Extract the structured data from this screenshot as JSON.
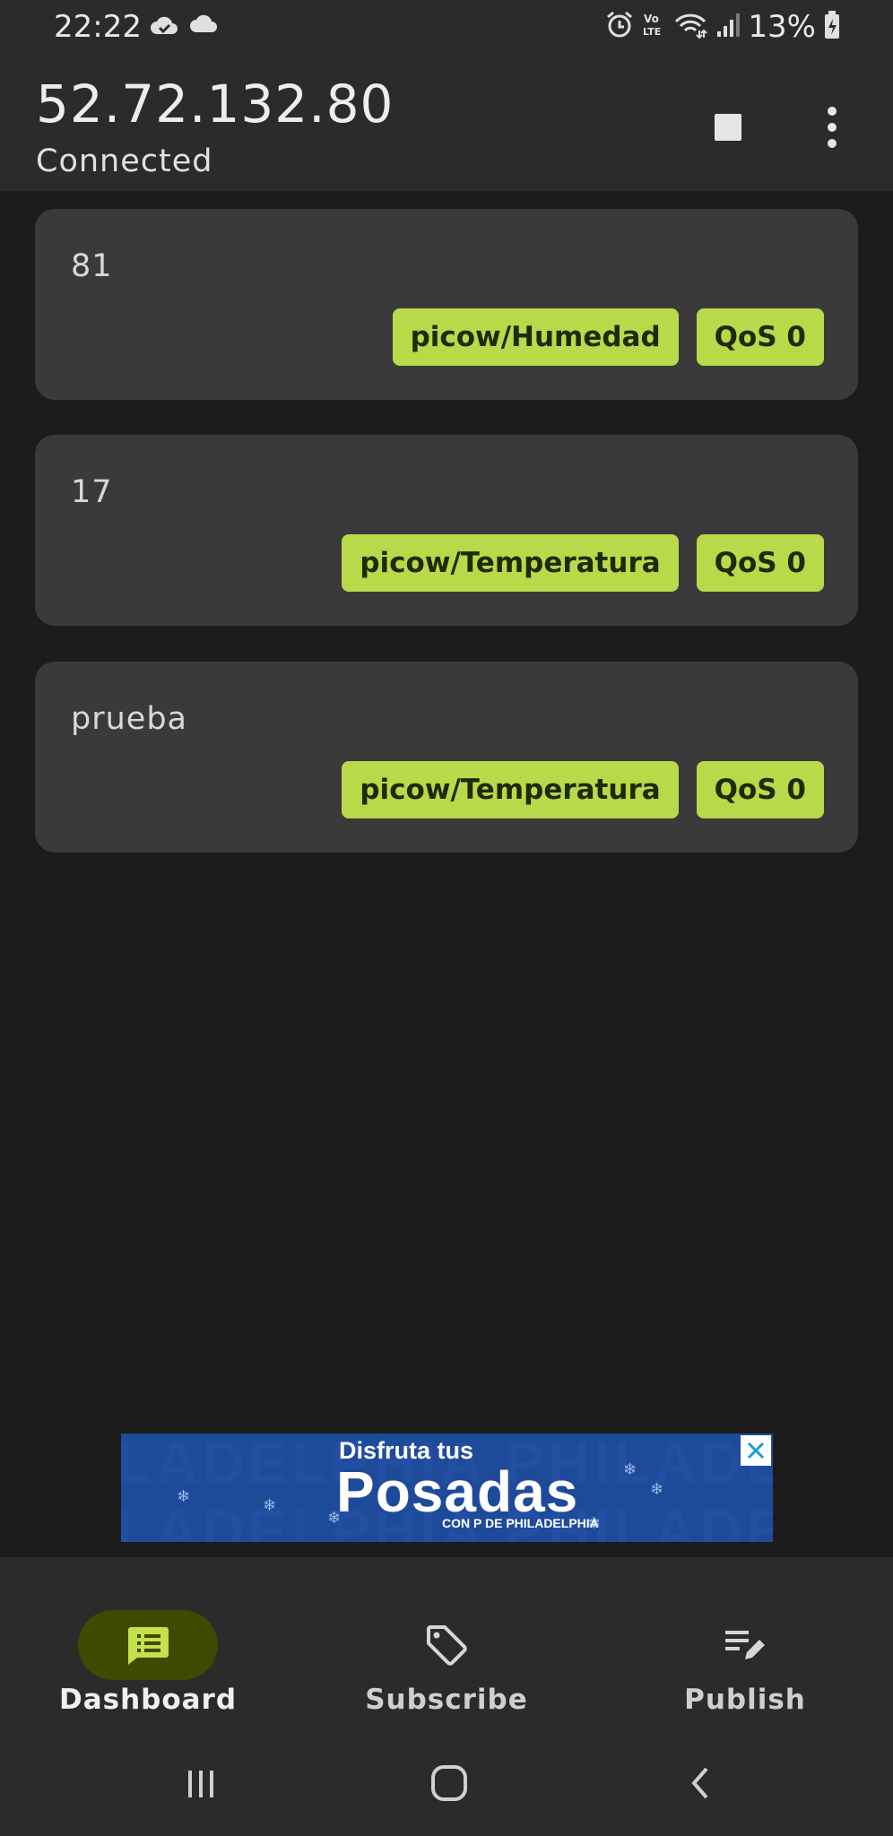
{
  "status_bar": {
    "time": "22:22",
    "left_icons": [
      "cloud-check-icon",
      "cloud-icon"
    ],
    "right_icons": [
      "alarm-icon",
      "volte-icon",
      "wifi-icon",
      "signal-icon",
      "battery-icon"
    ],
    "volte_text": "Vo\nLTE",
    "battery": "13%"
  },
  "app_bar": {
    "title": "52.72.132.80",
    "subtitle": "Connected",
    "actions": [
      "stop-icon",
      "more-vert-icon"
    ]
  },
  "messages": [
    {
      "payload": "81",
      "topic": "picow/Humedad",
      "qos": "QoS 0"
    },
    {
      "payload": "17",
      "topic": "picow/Temperatura",
      "qos": "QoS 0"
    },
    {
      "payload": "prueba",
      "topic": "picow/Temperatura",
      "qos": "QoS 0"
    }
  ],
  "ad": {
    "line1": "Disfruta tus",
    "line2": "Posadas",
    "line3": "CON P DE PHILADELPHIA",
    "bg_text": "LADELPHIA PHILADELPHIA",
    "close_icon": "close-icon"
  },
  "bottom_nav": {
    "items": [
      {
        "label": "Dashboard",
        "icon": "message-list-icon",
        "active": true
      },
      {
        "label": "Subscribe",
        "icon": "tag-icon",
        "active": false
      },
      {
        "label": "Publish",
        "icon": "edit-list-icon",
        "active": false
      }
    ]
  },
  "system_nav": [
    "recents-icon",
    "home-icon",
    "back-icon"
  ],
  "colors": {
    "background": "#1c1c1c",
    "surface": "#2b2b2b",
    "card": "#3a3a3a",
    "chip": "#b8d94a",
    "chip_text": "#1f2a05",
    "nav_active_pill": "#3f4a00",
    "ad_blue": "#1e4a9a"
  }
}
